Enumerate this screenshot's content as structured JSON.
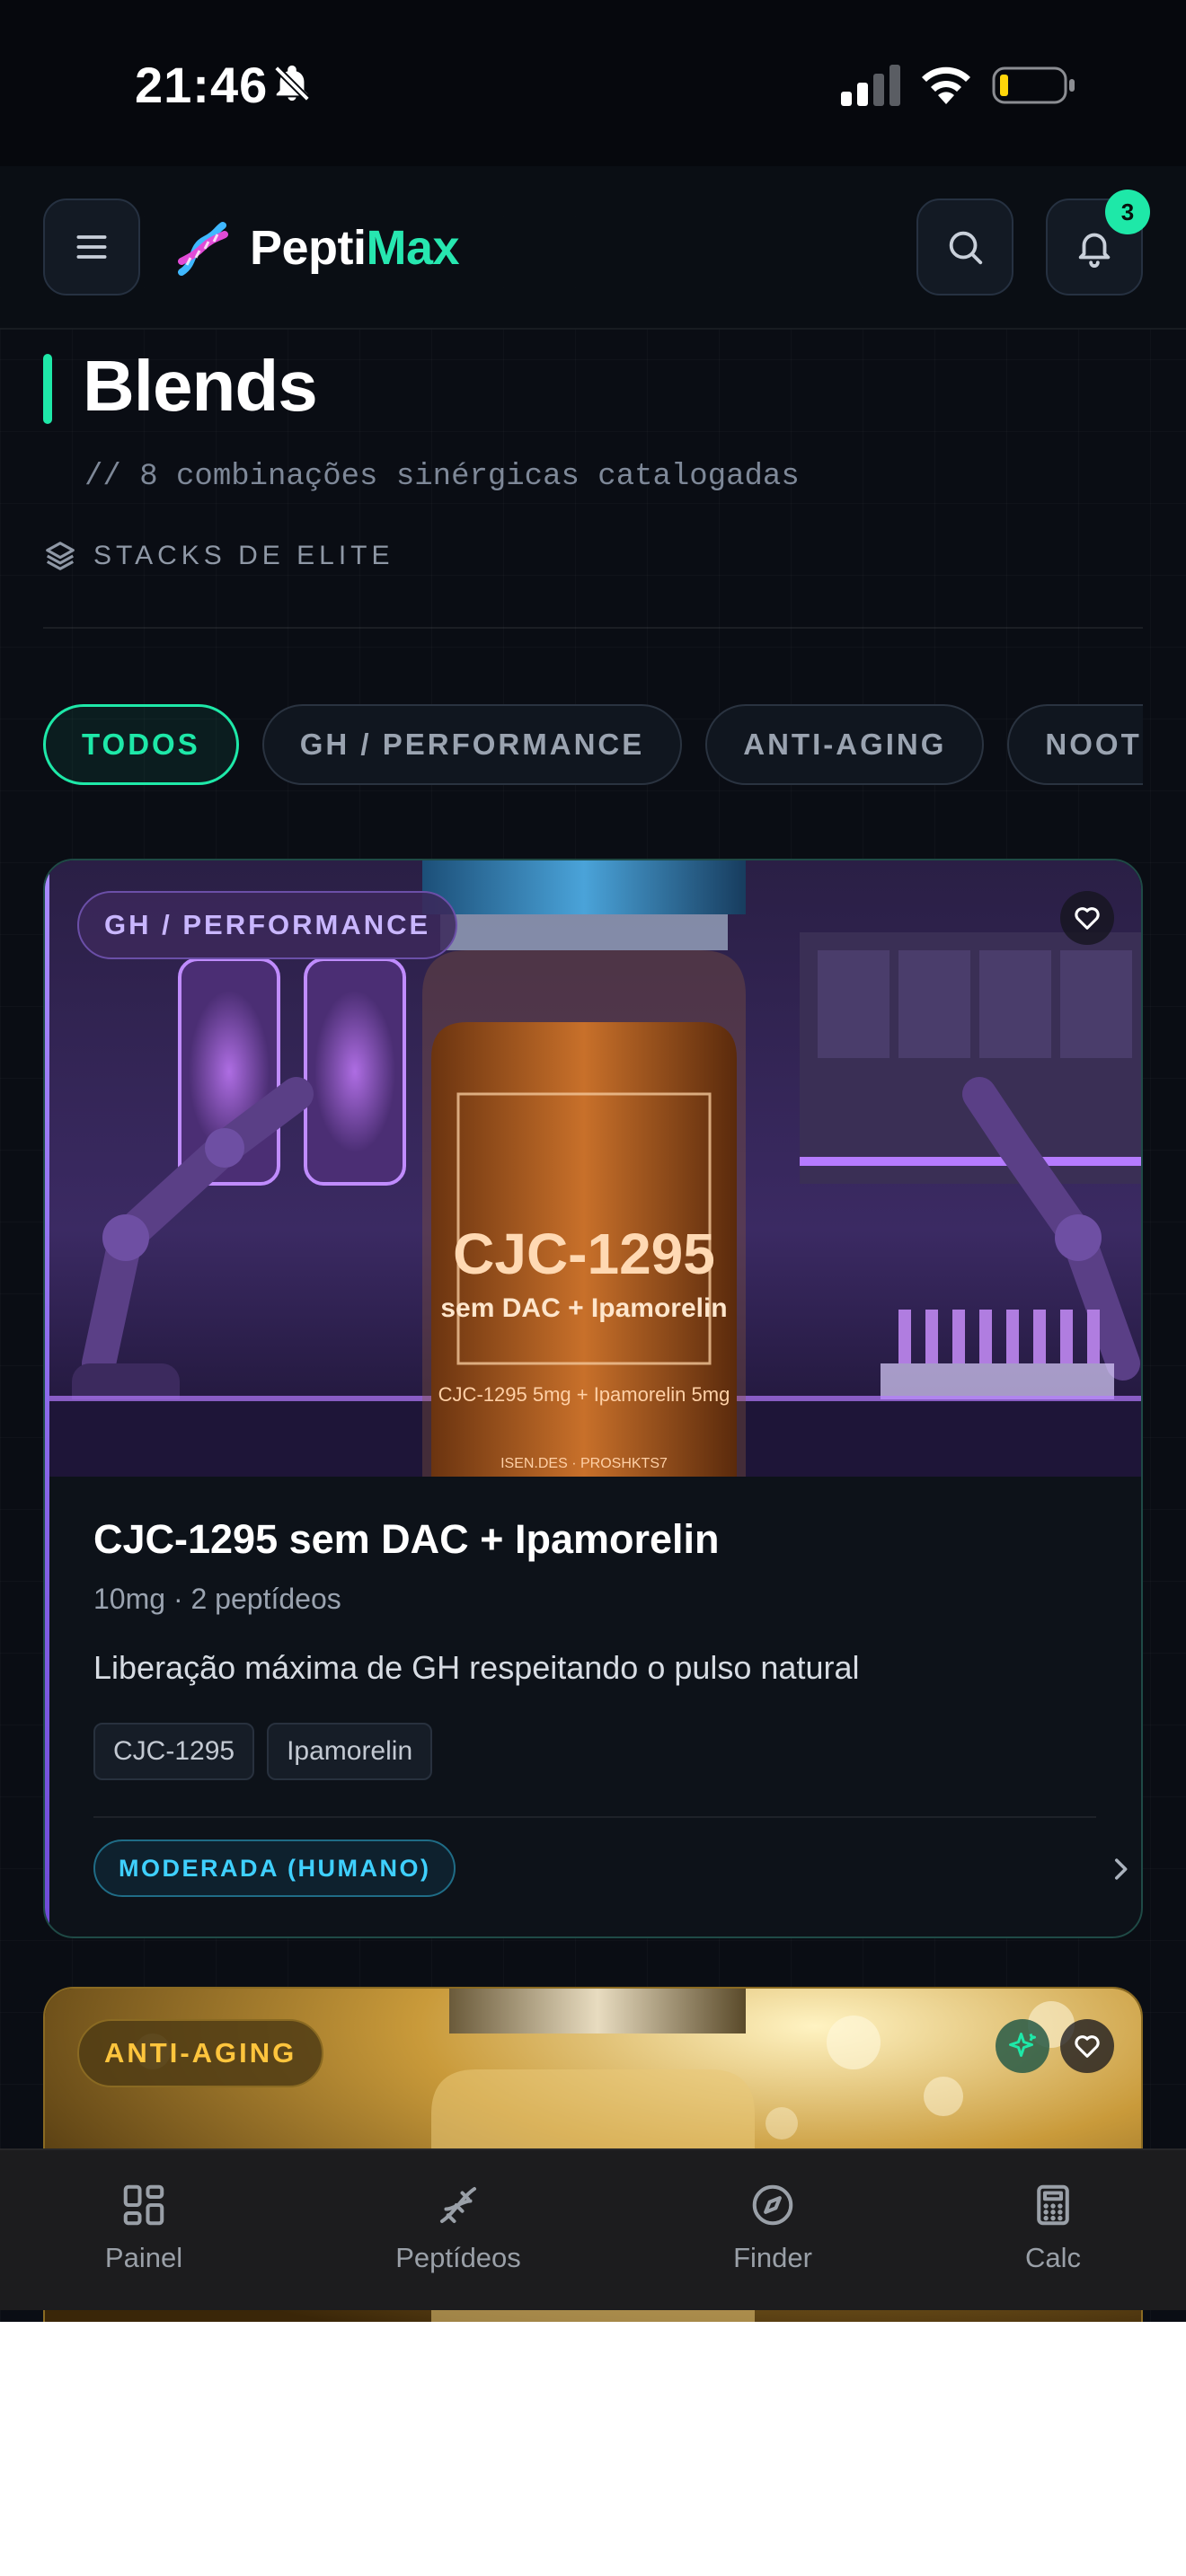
{
  "status_bar": {
    "time": "21:46",
    "icons": [
      "bell-slash-icon",
      "cellular-signal-icon",
      "wifi-icon",
      "battery-low-icon"
    ]
  },
  "header": {
    "brand_part1": "Pepti",
    "brand_part2": "Max",
    "notification_count": "3",
    "icons": [
      "menu-icon",
      "dna-logo-icon",
      "search-icon",
      "bell-icon"
    ]
  },
  "page": {
    "title": "Blends",
    "subtitle": "// 8 combinações sinérgicas catalogadas",
    "section_label": "STACKS DE ELITE",
    "section_icon": "layers-icon"
  },
  "filters": {
    "items": [
      {
        "label": "TODOS",
        "active": true
      },
      {
        "label": "GH / PERFORMANCE",
        "active": false
      },
      {
        "label": "ANTI-AGING",
        "active": false
      },
      {
        "label": "NOOTRÓPICOS",
        "active": false
      }
    ]
  },
  "cards": [
    {
      "category": "GH / PERFORMANCE",
      "image_text": {
        "line1": "CJC-1295",
        "line2": "sem DAC + Ipamorelin",
        "line3": "CJC-1295 5mg + Ipamorelin 5mg",
        "line4": "ISEN.DES · PROSHKTS7"
      },
      "title": "CJC-1295 sem DAC + Ipamorelin",
      "meta": "10mg · 2 peptídeos",
      "description": "Liberação máxima de GH respeitando o pulso natural",
      "tags": [
        "CJC-1295",
        "Ipamorelin"
      ],
      "risk_level": "MODERADA (HUMANO)",
      "favorite": false,
      "accent_color": "#8f6cf0"
    },
    {
      "category": "ANTI-AGING",
      "favorite": false,
      "featured": true,
      "accent_color": "#ffc53d"
    }
  ],
  "bottom_nav": {
    "items": [
      {
        "label": "Painel",
        "icon": "dashboard-grid-icon"
      },
      {
        "label": "Peptídeos",
        "icon": "dna-icon"
      },
      {
        "label": "Finder",
        "icon": "compass-icon"
      },
      {
        "label": "Calc",
        "icon": "calculator-icon"
      }
    ]
  },
  "colors": {
    "background": "#0a0d14",
    "accent_green": "#1ee8a8",
    "accent_purple": "#8f6cf0",
    "accent_gold": "#ffc53d",
    "risk_cyan": "#3fd0ff"
  }
}
